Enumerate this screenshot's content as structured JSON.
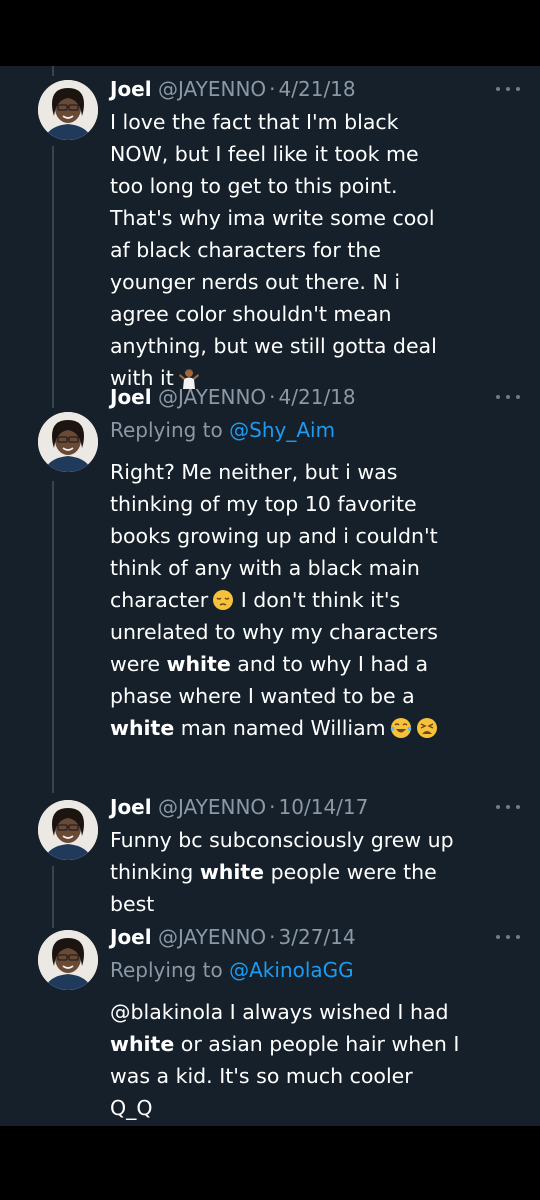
{
  "tweets": [
    {
      "name": "Joel",
      "handle": "@JAYENNO",
      "date": "4/21/18",
      "body_lines": [
        "I love the fact that I'm black",
        "NOW, but I feel like it took me",
        "too long to get to this point.",
        "That's why ima write some cool",
        "af black characters for the",
        "younger nerds out there. N i",
        "agree color shouldn't mean",
        "anything, but we still gotta deal",
        "with it"
      ],
      "emoji": [
        "person-shrugging-emoji"
      ]
    },
    {
      "name": "Joel",
      "handle": "@JAYENNO",
      "date": "4/21/18",
      "replying_prefix": "Replying to ",
      "replying_to": "@Shy_Aim",
      "body_lines": [
        "Right? Me neither, but i was",
        "thinking of my top 10 favorite",
        "books growing up and i couldn't",
        "think of any with a black main",
        "character",
        "I don't think it's",
        "unrelated to why my characters",
        "were",
        "white",
        "and to why I had a",
        "phase where I wanted to be a",
        "white",
        "man named William"
      ],
      "emoji": [
        "pensive-face-emoji",
        "tears-of-joy-emoji",
        "tired-face-emoji"
      ]
    },
    {
      "name": "Joel",
      "handle": "@JAYENNO",
      "date": "10/14/17",
      "body_lines": [
        "Funny bc subconsciously grew up",
        "thinking",
        "white",
        "people were the",
        "best"
      ]
    },
    {
      "name": "Joel",
      "handle": "@JAYENNO",
      "date": "3/27/14",
      "replying_prefix": "Replying to ",
      "replying_to": "@AkinolaGG",
      "body_lines": [
        "@blakinola I always wished I had",
        "white",
        "or asian people hair when I",
        "was a kid. It's so much cooler",
        "Q_Q"
      ]
    }
  ],
  "separator": "·",
  "colors": {
    "background": "#15202b",
    "text": "#ffffff",
    "secondary": "#8b98a5",
    "link": "#1d9bf0",
    "thread_line": "#38444d"
  }
}
